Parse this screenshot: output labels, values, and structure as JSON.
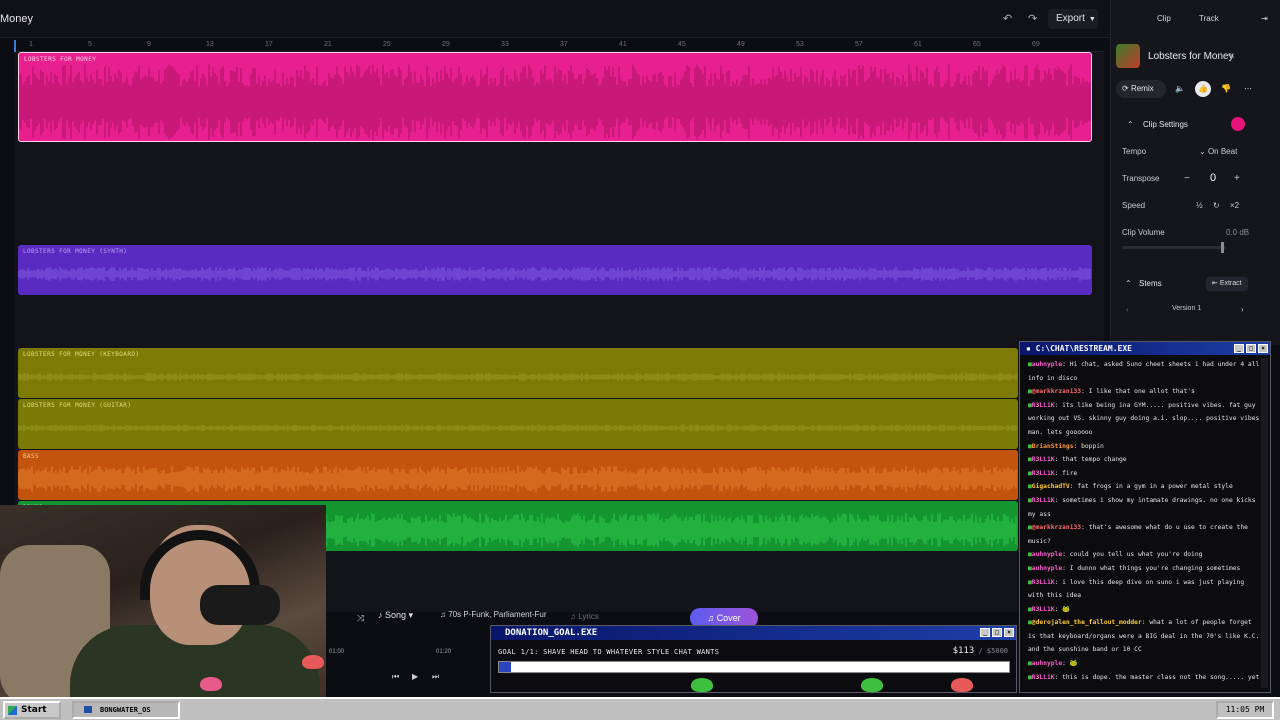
{
  "app": {
    "title": "Money",
    "export_label": "Export"
  },
  "ruler": {
    "marks": [
      "1",
      "5",
      "9",
      "13",
      "17",
      "21",
      "25",
      "29",
      "33",
      "37",
      "41",
      "45",
      "49",
      "53",
      "57",
      "61",
      "65",
      "69"
    ]
  },
  "tracks": [
    {
      "label": "LOBSTERS FOR MONEY",
      "color": "#e8208f",
      "wave": "#b4156a",
      "label_color": "#ffd2ea"
    },
    {
      "label": "LOBSTERS FOR MONEY (SYNTH)",
      "color": "#5a2bc0",
      "wave": "#7c55e0",
      "label_color": "#b9a4f2"
    },
    {
      "label": "LOBSTERS FOR MONEY (KEYBOARD)",
      "color": "#7d7a05",
      "wave": "#9a9620",
      "label_color": "#e3de7a"
    },
    {
      "label": "LOBSTERS FOR MONEY (GUITAR)",
      "color": "#7a7a06",
      "wave": "#95941e",
      "label_color": "#e3de7a"
    },
    {
      "label": "BASS",
      "color": "#c2540e",
      "wave": "#e07a2a",
      "label_color": "#ffc59a"
    },
    {
      "label": "DRUMS",
      "color": "#13962f",
      "wave": "#2cc24a",
      "label_color": "#a8f0b5"
    }
  ],
  "right_panel": {
    "tabs": [
      "Clip",
      "Track"
    ],
    "song_title": "Lobsters for Money",
    "remix_label": "Remix",
    "clip_settings_label": "Clip Settings",
    "tempo_label": "Tempo",
    "tempo_value": "On Beat",
    "transpose_label": "Transpose",
    "transpose_value": "0",
    "speed_label": "Speed",
    "speed_half": "½",
    "speed_double": "×2",
    "clip_volume_label": "Clip Volume",
    "clip_volume_value": "0.0 dB",
    "clip_volume_level": 0.95,
    "stems_label": "Stems",
    "extract_label": "Extract",
    "version_label": "Version 1",
    "accent": "#e8137a"
  },
  "chat": {
    "title": "C:\\CHAT\\RESTREAM.EXE",
    "messages": [
      {
        "user": "auhnyple",
        "color": "#ff5fd2",
        "text": "Hi chat, asked Suno cheet sheets i had under 4 all info in disco"
      },
      {
        "user": "@markkrzani33",
        "color": "#ff6a6a",
        "text": "I like that one allot that's"
      },
      {
        "user": "R3LL1K",
        "color": "#ff5fd2",
        "text": "its like being ina GYM..... positive vibes. fat guy working out VS. skinny guy doing a.i. slop.... positive vibes man. lets goooooo"
      },
      {
        "user": "BrianStings",
        "color": "#ff9a3a",
        "text": "boppin"
      },
      {
        "user": "R3LL1K",
        "color": "#ff5fd2",
        "text": "that tempo change"
      },
      {
        "user": "R3LL1K",
        "color": "#ff5fd2",
        "text": "fire"
      },
      {
        "user": "GigachadTV",
        "color": "#ffcc33",
        "text": "fat frogs in a gym in a power metal style"
      },
      {
        "user": "R3LL1K",
        "color": "#ff5fd2",
        "text": "sometimes i show my intamate drawings. no one kicks my ass"
      },
      {
        "user": "@markkrzani33",
        "color": "#ff6a6a",
        "text": "that's awesome what do u use to create the music?"
      },
      {
        "user": "auhnyple",
        "color": "#ff5fd2",
        "text": "could you tell us what you're doing"
      },
      {
        "user": "auhnyple",
        "color": "#ff5fd2",
        "text": "I dunno what things you're changing sometimes"
      },
      {
        "user": "R3LL1K",
        "color": "#ff5fd2",
        "text": "i love this deep dive on suno i was just playing with this idea"
      },
      {
        "user": "R3LL1K",
        "color": "#ff5fd2",
        "text": "🐸"
      },
      {
        "user": "@derojalen_the_fallout_modder",
        "color": "#ffcc33",
        "text": "what a lot of people forget is that keyboard/organs were a BIG deal in the 70's like K.C. and the sunshine band or 10 CC"
      },
      {
        "user": "auhnyple",
        "color": "#ff5fd2",
        "text": "🐸"
      },
      {
        "user": "R3LL1K",
        "color": "#ff5fd2",
        "text": "this is dope. the master class not the song..... yet"
      }
    ]
  },
  "bottom_controls": {
    "song_label": "Song",
    "style_value": "70s P-Funk, Parliament-Fur",
    "lyrics_placeholder": "Lyrics",
    "cover_label": "Cover",
    "time_marks": [
      "01:00",
      "01:20"
    ]
  },
  "donation": {
    "title": "DONATION_GOAL.EXE",
    "goal_text": "GOAL 1/1: SHAVE HEAD TO WHATEVER STYLE CHAT WANTS",
    "current": "$113",
    "target": " / $5000",
    "progress": 0.0226
  },
  "taskbar": {
    "start_label": "Start",
    "task_label": "BONGWATER_OS",
    "clock": "11:05 PM"
  }
}
